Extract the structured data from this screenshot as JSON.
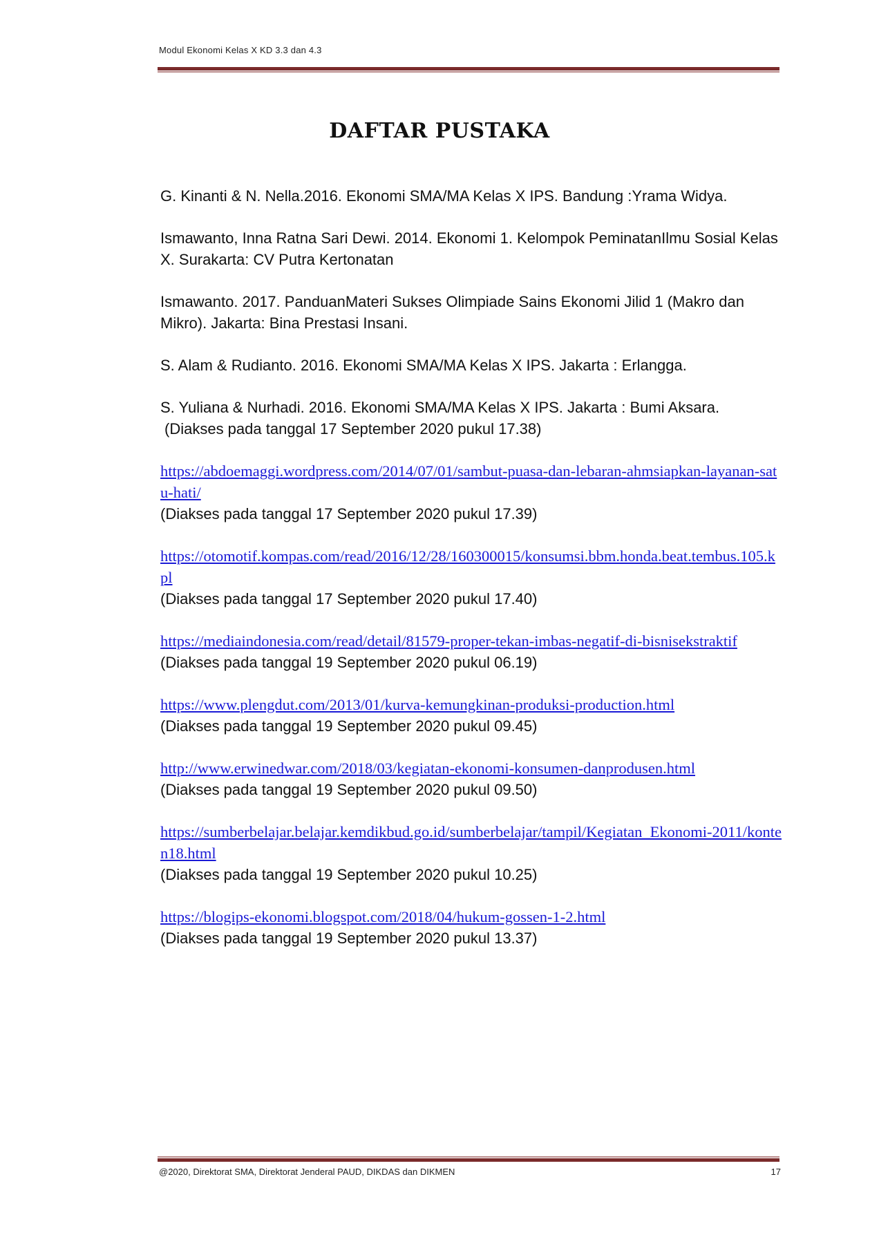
{
  "header": {
    "text": "Modul Ekonomi Kelas X KD 3.3 dan 4.3"
  },
  "title": "DAFTAR PUSTAKA",
  "books": [
    {
      "text": "G. Kinanti & N. Nella.2016. Ekonomi SMA/MA Kelas X IPS. Bandung :Yrama Widya."
    },
    {
      "text": "Ismawanto, Inna Ratna Sari Dewi. 2014. Ekonomi  1. Kelompok PeminatanIlmu Sosial Kelas X. Surakarta: CV Putra Kertonatan"
    },
    {
      "text": "Ismawanto. 2017. PanduanMateri Sukses Olimpiade Sains Ekonomi Jilid 1 (Makro dan Mikro). Jakarta: Bina Prestasi Insani."
    },
    {
      "text": "S. Alam & Rudianto. 2016. Ekonomi SMA/MA Kelas X  IPS. Jakarta :  Erlangga."
    },
    {
      "text": "S. Yuliana & Nurhadi. 2016. Ekonomi SMA/MA Kelas X  IPS. Jakarta :  Bumi Aksara.",
      "accessed": "(Diakses pada tanggal 17 September 2020 pukul 17.38)"
    }
  ],
  "links": [
    {
      "url": "https://abdoemaggi.wordpress.com/2014/07/01/sambut-puasa-dan-lebaran-ahmsiapkan-layanan-satu-hati/",
      "accessed": "(Diakses pada tanggal 17 September 2020 pukul 17.39)"
    },
    {
      "url": "https://otomotif.kompas.com/read/2016/12/28/160300015/konsumsi.bbm.honda.beat.tembus.105.kpl",
      "accessed": "(Diakses pada tanggal 17 September 2020 pukul 17.40)"
    },
    {
      "url": "https://mediaindonesia.com/read/detail/81579-proper-tekan-imbas-negatif-di-bisnisekstraktif",
      "accessed": "(Diakses pada tanggal 19 September 2020 pukul 06.19)"
    },
    {
      "url": "https://www.plengdut.com/2013/01/kurva-kemungkinan-produksi-production.html",
      "accessed": "(Diakses pada tanggal 19 September 2020 pukul 09.45)"
    },
    {
      "url": "http://www.erwinedwar.com/2018/03/kegiatan-ekonomi-konsumen-danprodusen.html",
      "accessed": "(Diakses pada tanggal 19 September 2020 pukul 09.50)"
    },
    {
      "url": "https://sumberbelajar.belajar.kemdikbud.go.id/sumberbelajar/tampil/Kegiatan_Ekonomi-2011/konten18.html",
      "accessed": "(Diakses pada tanggal 19 September 2020 pukul 10.25)"
    },
    {
      "url": "https://blogips-ekonomi.blogspot.com/2018/04/hukum-gossen-1-2.html",
      "accessed": "(Diakses pada tanggal 19 September 2020 pukul 13.37)"
    }
  ],
  "footer": {
    "text": "@2020, Direktorat SMA, Direktorat Jenderal PAUD, DIKDAS dan DIKMEN",
    "page_number": "17"
  },
  "colors": {
    "rule": "#7a2b2b",
    "link": "#1a1ad6"
  }
}
